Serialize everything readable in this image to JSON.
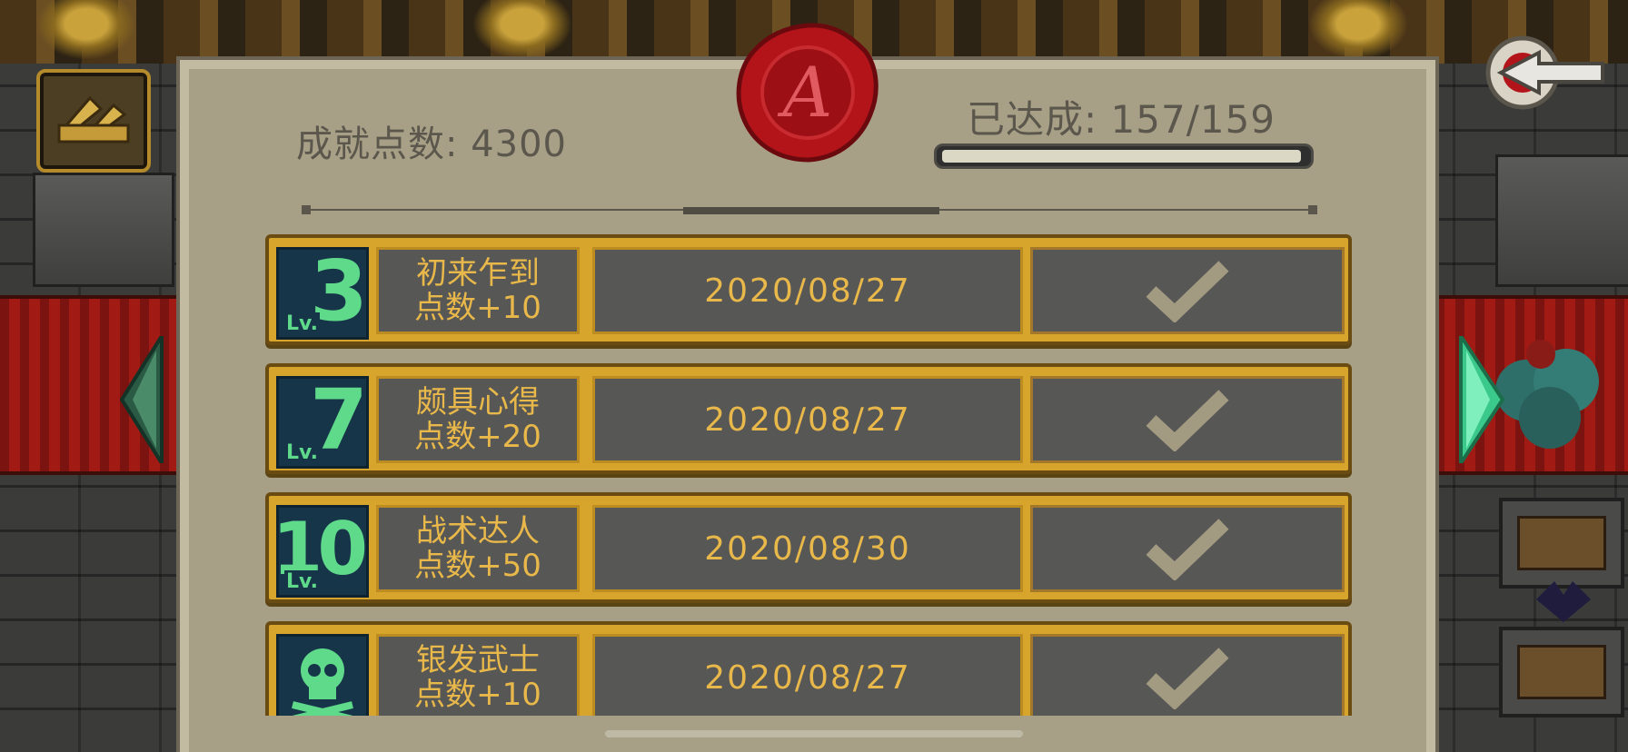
{
  "header": {
    "points_label": "成就点数",
    "points_value": "4300",
    "achieved_label": "已达成",
    "achieved_value": "157/159",
    "progress_fraction": 0.987
  },
  "seal": {
    "letter": "A"
  },
  "achievements": [
    {
      "level": "3",
      "lv_label": "Lv.",
      "name": "初来乍到",
      "reward": "点数+10",
      "date": "2020/08/27",
      "completed": true
    },
    {
      "level": "7",
      "lv_label": "Lv.",
      "name": "颇具心得",
      "reward": "点数+20",
      "date": "2020/08/27",
      "completed": true
    },
    {
      "level": "10",
      "lv_label": "Lv.",
      "name": "战术达人",
      "reward": "点数+50",
      "date": "2020/08/30",
      "completed": true
    },
    {
      "icon": "skull-icon",
      "name": "银发武士",
      "reward": "点数+10",
      "date": "2020/08/27",
      "completed": true
    }
  ],
  "colors": {
    "parchment": "#a79f86",
    "gold": "#d8a52c",
    "text_gold": "#e9b84a",
    "badge_bg": "#163549",
    "badge_text": "#5fd98a",
    "seal_red": "#b3141a"
  }
}
